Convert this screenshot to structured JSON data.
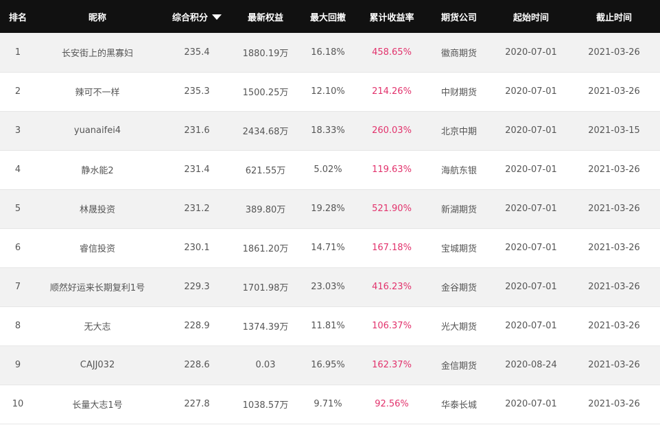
{
  "colors": {
    "header_bg": "#111111",
    "header_text": "#ffffff",
    "row_odd": "#f2f2f2",
    "row_even": "#ffffff",
    "text": "#555555",
    "return_highlight": "#e2326c"
  },
  "table": {
    "headers": {
      "rank": "排名",
      "nickname": "昵称",
      "score": "综合积分",
      "equity": "最新权益",
      "drawdown": "最大回撤",
      "return": "累计收益率",
      "broker": "期货公司",
      "start": "起始时间",
      "end": "截止时间"
    },
    "sort_icon": "caret-down-icon",
    "rows": [
      {
        "rank": "1",
        "nickname": "长安街上的黑寡妇",
        "score": "235.4",
        "equity": "1880.19万",
        "drawdown": "16.18%",
        "return": "458.65%",
        "broker": "徽商期货",
        "start": "2020-07-01",
        "end": "2021-03-26"
      },
      {
        "rank": "2",
        "nickname": "辣可不一样",
        "score": "235.3",
        "equity": "1500.25万",
        "drawdown": "12.10%",
        "return": "214.26%",
        "broker": "中财期货",
        "start": "2020-07-01",
        "end": "2021-03-26"
      },
      {
        "rank": "3",
        "nickname": "yuanaifei4",
        "score": "231.6",
        "equity": "2434.68万",
        "drawdown": "18.33%",
        "return": "260.03%",
        "broker": "北京中期",
        "start": "2020-07-01",
        "end": "2021-03-15"
      },
      {
        "rank": "4",
        "nickname": "静水能2",
        "score": "231.4",
        "equity": "621.55万",
        "drawdown": "5.02%",
        "return": "119.63%",
        "broker": "海航东银",
        "start": "2020-07-01",
        "end": "2021-03-26"
      },
      {
        "rank": "5",
        "nickname": "林晟投资",
        "score": "231.2",
        "equity": "389.80万",
        "drawdown": "19.28%",
        "return": "521.90%",
        "broker": "新湖期货",
        "start": "2020-07-01",
        "end": "2021-03-26"
      },
      {
        "rank": "6",
        "nickname": "睿信投资",
        "score": "230.1",
        "equity": "1861.20万",
        "drawdown": "14.71%",
        "return": "167.18%",
        "broker": "宝城期货",
        "start": "2020-07-01",
        "end": "2021-03-26"
      },
      {
        "rank": "7",
        "nickname": "顺然好运来长期复利1号",
        "score": "229.3",
        "equity": "1701.98万",
        "drawdown": "23.03%",
        "return": "416.23%",
        "broker": "金谷期货",
        "start": "2020-07-01",
        "end": "2021-03-26"
      },
      {
        "rank": "8",
        "nickname": "无大志",
        "score": "228.9",
        "equity": "1374.39万",
        "drawdown": "11.81%",
        "return": "106.37%",
        "broker": "光大期货",
        "start": "2020-07-01",
        "end": "2021-03-26"
      },
      {
        "rank": "9",
        "nickname": "CAJJ032",
        "score": "228.6",
        "equity": "0.03",
        "drawdown": "16.95%",
        "return": "162.37%",
        "broker": "金信期货",
        "start": "2020-08-24",
        "end": "2021-03-26"
      },
      {
        "rank": "10",
        "nickname": "长量大志1号",
        "score": "227.8",
        "equity": "1038.57万",
        "drawdown": "9.71%",
        "return": "92.56%",
        "broker": "华泰长城",
        "start": "2020-07-01",
        "end": "2021-03-26"
      }
    ]
  }
}
